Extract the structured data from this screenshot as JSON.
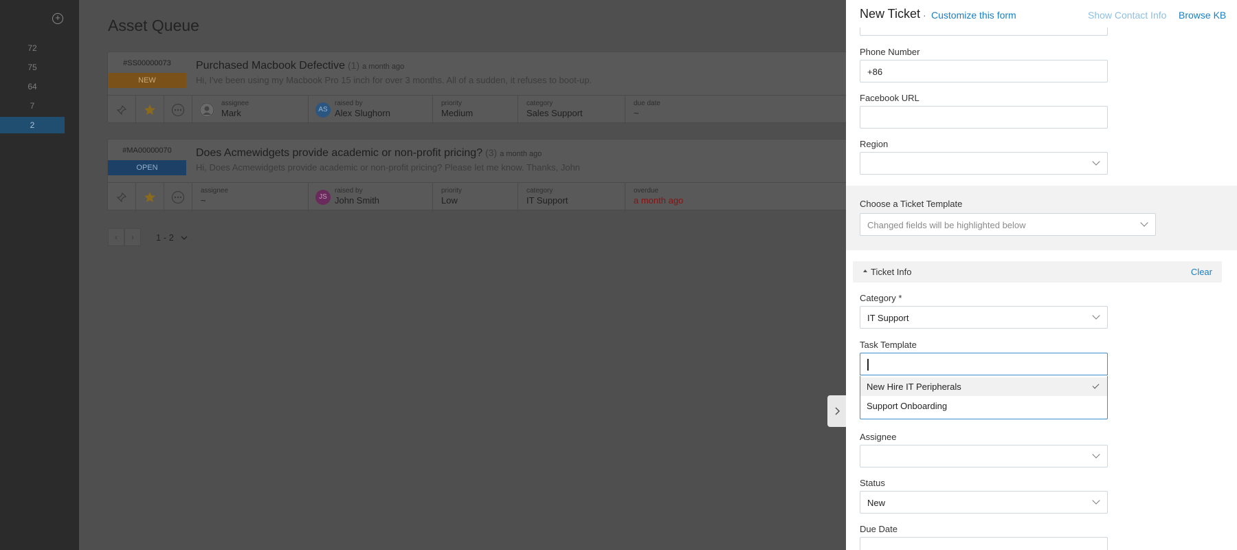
{
  "sidebar": {
    "add_label": "+",
    "counts": [
      "72",
      "75",
      "64",
      "7",
      "2"
    ]
  },
  "main": {
    "title": "Asset Queue",
    "tickets": [
      {
        "id": "#SS00000073",
        "status": "NEW",
        "title": "Purchased Macbook Defective",
        "reply_count": "(1)",
        "time": "a month ago",
        "snippet": "Hi, I've been using my Macbook Pro 15 inch for over 3 months. All of a sudden, it refuses to boot-up.",
        "assignee_label": "assignee",
        "assignee": "Mark",
        "raised_label": "raised by",
        "raised_by": "Alex Slughorn",
        "raised_initials": "AS",
        "priority_label": "priority",
        "priority": "Medium",
        "category_label": "category",
        "category": "Sales Support",
        "due_label": "due date",
        "due": "~"
      },
      {
        "id": "#MA00000070",
        "status": "OPEN",
        "title": "Does Acmewidgets provide academic or non-profit pricing?",
        "reply_count": "(3)",
        "time": "a month ago",
        "snippet": "Hi, Does Acmewidgets provide academic or non-profit pricing? Please let me know. Thanks, John",
        "assignee_label": "assignee",
        "assignee": "~",
        "raised_label": "raised by",
        "raised_by": "John Smith",
        "raised_initials": "JS",
        "priority_label": "priority",
        "priority": "Low",
        "category_label": "category",
        "category": "IT Support",
        "due_label": "overdue",
        "due": "a month ago"
      }
    ],
    "pager": {
      "prev": "‹",
      "next": "›",
      "range": "1 - 2"
    }
  },
  "panel": {
    "title": "New Ticket",
    "separator": "·",
    "customize": "Customize this form",
    "show_contact": "Show Contact Info",
    "browse_kb": "Browse KB",
    "phone_label": "Phone Number",
    "phone_value": "+86",
    "facebook_label": "Facebook URL",
    "facebook_value": "",
    "region_label": "Region",
    "region_value": "",
    "template_label": "Choose a Ticket Template",
    "template_placeholder": "Changed fields will be highlighted below",
    "ticket_info": "Ticket Info",
    "clear": "Clear",
    "category_label": "Category *",
    "category_value": "IT Support",
    "task_template_label": "Task Template",
    "task_template_value": "",
    "task_options": [
      "New Hire IT Peripherals",
      "Support Onboarding"
    ],
    "selected_option": "New Hire IT Peripherals",
    "assignee_label": "Assignee",
    "assignee_value": "",
    "status_label": "Status",
    "status_value": "New",
    "due_date_label": "Due Date"
  },
  "colors": {
    "accent": "#1a7fc1",
    "badge_new": "#7a5219",
    "badge_open": "#1c4066",
    "overdue": "#8a1111"
  }
}
